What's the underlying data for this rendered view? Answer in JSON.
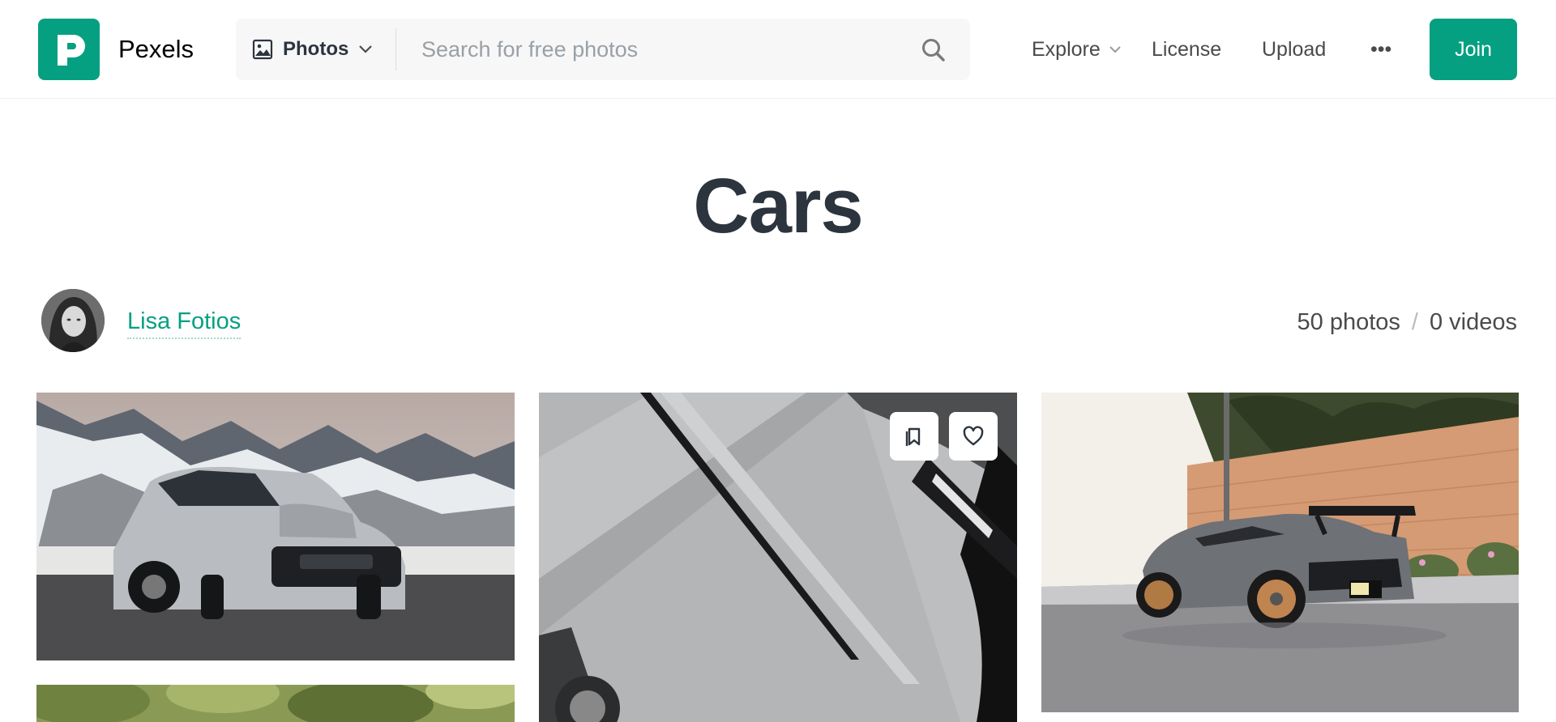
{
  "header": {
    "brand": "Pexels",
    "search": {
      "type_label": "Photos",
      "placeholder": "Search for free photos"
    },
    "nav": {
      "explore": "Explore",
      "license": "License",
      "upload": "Upload",
      "more": "•••"
    },
    "join_label": "Join",
    "accent_color": "#05a081"
  },
  "collection": {
    "title": "Cars",
    "owner_name": "Lisa Fotios",
    "photo_count": "50 photos",
    "separator": "/",
    "video_count": "0 videos"
  },
  "icons": {
    "logo": "pexels-logo-icon",
    "type": "image-icon",
    "dropdown": "chevron-down-icon",
    "search": "search-icon",
    "collect": "bookmark-collect-icon",
    "like": "heart-icon"
  }
}
